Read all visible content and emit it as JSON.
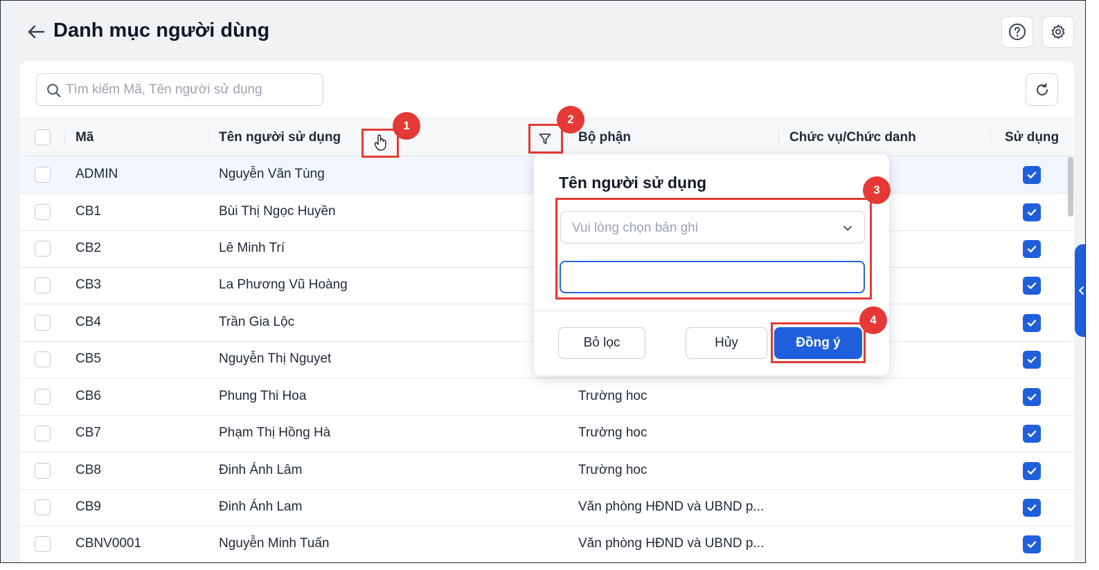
{
  "header": {
    "title": "Danh mục người dùng"
  },
  "search": {
    "placeholder": "Tìm kiếm Mã, Tên người sử dụng"
  },
  "table": {
    "columns": [
      "Mã",
      "Tên người sử dụng",
      "Bộ phận",
      "Chức vụ/Chức danh",
      "Sử dụng"
    ],
    "rows": [
      {
        "code": "ADMIN",
        "name": "Nguyễn Văn Tùng",
        "dept": "",
        "title": "",
        "active": true
      },
      {
        "code": "CB1",
        "name": "Bùi Thị Ngọc Huyền",
        "dept": "",
        "title": "",
        "active": true
      },
      {
        "code": "CB2",
        "name": "Lê Minh Trí",
        "dept": "",
        "title": "",
        "active": true
      },
      {
        "code": "CB3",
        "name": "La Phương Vũ Hoàng",
        "dept": "",
        "title": "",
        "active": true
      },
      {
        "code": "CB4",
        "name": "Trần Gia Lộc",
        "dept": "",
        "title": "",
        "active": true
      },
      {
        "code": "CB5",
        "name": "Nguyễn Thị Nguyet",
        "dept": "",
        "title": "",
        "active": true
      },
      {
        "code": "CB6",
        "name": "Phung Thi Hoa",
        "dept": "Trường hoc",
        "title": "",
        "active": true
      },
      {
        "code": "CB7",
        "name": "Phạm Thị Hồng Hà",
        "dept": "Trường hoc",
        "title": "",
        "active": true
      },
      {
        "code": "CB8",
        "name": "Đinh Ánh Lâm",
        "dept": "Trường hoc",
        "title": "",
        "active": true
      },
      {
        "code": "CB9",
        "name": "Đinh Ánh Lam",
        "dept": "Văn phòng HĐND và UBND p...",
        "title": "",
        "active": true
      },
      {
        "code": "CBNV0001",
        "name": "Nguyễn Minh Tuấn",
        "dept": "Văn phòng HĐND và UBND p...",
        "title": "",
        "active": true
      }
    ]
  },
  "filter_popup": {
    "title": "Tên người sử dụng",
    "select_placeholder": "Vui lòng chọn bản ghi",
    "input_value": "",
    "clear_label": "Bỏ lọc",
    "cancel_label": "Hủy",
    "apply_label": "Đồng ý"
  },
  "annotations": [
    "1",
    "2",
    "3",
    "4"
  ],
  "colors": {
    "accent": "#1f5fdc",
    "highlight": "#e53935",
    "background": "#f1f2f4"
  },
  "icons": [
    "back-arrow-icon",
    "help-icon",
    "gear-icon",
    "search-icon",
    "refresh-icon",
    "hand-cursor-icon",
    "filter-icon",
    "chevron-down-icon",
    "check-icon",
    "chevron-left-icon"
  ]
}
